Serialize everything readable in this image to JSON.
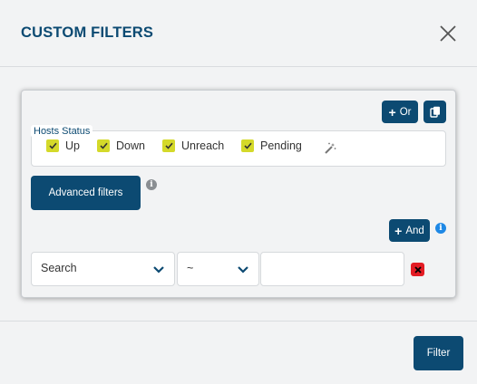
{
  "modal": {
    "title": "CUSTOM FILTERS"
  },
  "filter_group": {
    "or_label": "Or",
    "and_label": "And",
    "hosts_status": {
      "legend": "Hosts Status",
      "options": [
        {
          "label": "Up",
          "checked": true
        },
        {
          "label": "Down",
          "checked": true
        },
        {
          "label": "Unreach",
          "checked": true
        },
        {
          "label": "Pending",
          "checked": true
        }
      ]
    },
    "advanced_filters_label": "Advanced filters",
    "condition": {
      "field": "Search",
      "operator": "~",
      "value": ""
    }
  },
  "footer": {
    "filter_label": "Filter"
  },
  "colors": {
    "primary": "#0c4a72",
    "checkbox": "#d4d92a",
    "danger": "#e31b23",
    "info": "#1e88e5"
  },
  "icons": [
    "close-icon",
    "plus-icon",
    "copy-icon",
    "check-icon",
    "magic-wand-icon",
    "info-icon",
    "chevron-down-icon",
    "remove-icon"
  ]
}
